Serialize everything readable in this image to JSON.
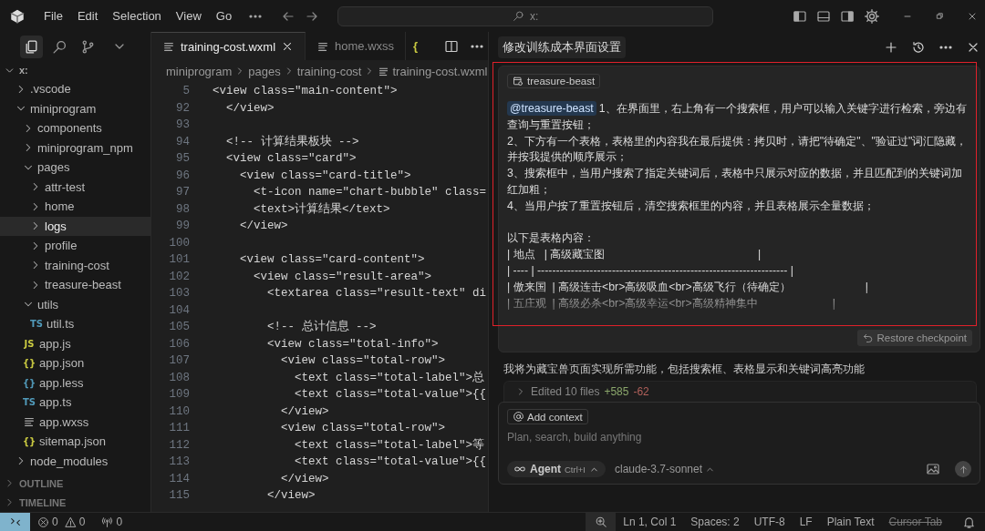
{
  "titlebar": {
    "menus": [
      "File",
      "Edit",
      "Selection",
      "View",
      "Go"
    ],
    "search": {
      "value": "x:"
    }
  },
  "activity": [
    {
      "selected": true
    },
    {
      "selected": false
    },
    {
      "selected": false
    }
  ],
  "explorer": {
    "root": "x:",
    "expanded": true,
    "tree": [
      {
        "label": ".vscode",
        "kind": "folder",
        "expanded": false,
        "selected": false
      },
      {
        "label": "miniprogram",
        "kind": "folder",
        "expanded": true,
        "selected": false,
        "children": [
          {
            "label": "components",
            "kind": "folder",
            "expanded": false,
            "selected": false
          },
          {
            "label": "miniprogram_npm",
            "kind": "folder",
            "expanded": false,
            "selected": false
          },
          {
            "label": "pages",
            "kind": "folder",
            "expanded": true,
            "selected": false,
            "children": [
              {
                "label": "attr-test",
                "kind": "folder",
                "expanded": false,
                "selected": false
              },
              {
                "label": "home",
                "kind": "folder",
                "expanded": false,
                "selected": false
              },
              {
                "label": "logs",
                "kind": "folder",
                "expanded": false,
                "selected": true
              },
              {
                "label": "profile",
                "kind": "folder",
                "expanded": false,
                "selected": false
              },
              {
                "label": "training-cost",
                "kind": "folder",
                "expanded": false,
                "selected": false
              },
              {
                "label": "treasure-beast",
                "kind": "folder",
                "expanded": false,
                "selected": false
              }
            ]
          },
          {
            "label": "utils",
            "kind": "folder",
            "expanded": true,
            "selected": false,
            "children": [
              {
                "label": "util.ts",
                "kind": "ts",
                "icon_text": "TS",
                "selected": false
              }
            ]
          },
          {
            "label": "app.js",
            "kind": "js",
            "icon_text": "JS",
            "selected": false
          },
          {
            "label": "app.json",
            "kind": "json",
            "icon_text": "{}",
            "selected": false
          },
          {
            "label": "app.less",
            "kind": "less",
            "icon_text": "{}",
            "selected": false
          },
          {
            "label": "app.ts",
            "kind": "ts",
            "icon_text": "TS",
            "selected": false
          },
          {
            "label": "app.wxss",
            "kind": "lines",
            "selected": false
          },
          {
            "label": "sitemap.json",
            "kind": "json",
            "icon_text": "{}",
            "selected": false
          }
        ]
      },
      {
        "label": "node_modules",
        "kind": "folder",
        "expanded": false,
        "selected": false
      }
    ],
    "sections": [
      {
        "label": "OUTLINE",
        "expanded": false
      },
      {
        "label": "TIMELINE",
        "expanded": false
      }
    ]
  },
  "editor": {
    "tabs": [
      {
        "label": "training-cost.wxml",
        "kind": "lines",
        "selected": true
      },
      {
        "label": "home.wxss",
        "kind": "lines",
        "selected": false
      },
      {
        "kind": "json",
        "icon_text": "{",
        "selected": false
      }
    ],
    "breadcrumbs": [
      "miniprogram",
      "pages",
      "training-cost",
      "training-cost.wxml"
    ],
    "lines": [
      {
        "num": "5",
        "text": "<view class=\"main-content\">"
      },
      {
        "num": "92",
        "text": "  </view>"
      },
      {
        "num": "93"
      },
      {
        "num": "94",
        "text": "  <!-- 计算结果板块 -->"
      },
      {
        "num": "95",
        "text": "  <view class=\"card\">"
      },
      {
        "num": "96",
        "text": "    <view class=\"card-title\">"
      },
      {
        "num": "97",
        "text": "      <t-icon name=\"chart-bubble\" class="
      },
      {
        "num": "98",
        "text": "      <text>计算结果</text>"
      },
      {
        "num": "99",
        "text": "    </view>"
      },
      {
        "num": "100"
      },
      {
        "num": "101",
        "text": "    <view class=\"card-content\">"
      },
      {
        "num": "102",
        "text": "      <view class=\"result-area\">"
      },
      {
        "num": "103",
        "text": "        <textarea class=\"result-text\" di"
      },
      {
        "num": "104"
      },
      {
        "num": "105",
        "text": "        <!-- 总计信息 -->"
      },
      {
        "num": "106",
        "text": "        <view class=\"total-info\">"
      },
      {
        "num": "107",
        "text": "          <view class=\"total-row\">"
      },
      {
        "num": "108",
        "text": "            <text class=\"total-label\">总"
      },
      {
        "num": "109",
        "text": "            <text class=\"total-value\">{{"
      },
      {
        "num": "110",
        "text": "          </view>"
      },
      {
        "num": "111",
        "text": "          <view class=\"total-row\">"
      },
      {
        "num": "112",
        "text": "            <text class=\"total-label\">等"
      },
      {
        "num": "113",
        "text": "            <text class=\"total-value\">{{"
      },
      {
        "num": "114",
        "text": "          </view>"
      },
      {
        "num": "115",
        "text": "        </view>"
      }
    ]
  },
  "chat": {
    "title": "修改训练成本界面设置",
    "message": {
      "highlighted": true,
      "context": "treasure-beast",
      "mention": "@treasure-beast",
      "lines": [
        {
          "kind": "item",
          "text": "1、在界面里，右上角有一个搜索框，用户可以输入关键字进行检索，旁边有查询与重置按钮；"
        },
        {
          "kind": "item",
          "text": "2、下方有一个表格，表格里的内容我在最后提供：拷贝时，请把\"待确定\"、\"验证过\"词汇隐藏，并按我提供的顺序展示；"
        },
        {
          "kind": "item",
          "text": "3、搜索框中，当用户搜索了指定关键词后，表格中只展示对应的数据，并且匹配到的关键词加红加粗；"
        },
        {
          "kind": "item",
          "text": "4、当用户按了重置按钮后，清空搜索框里的内容，并且表格展示全量数据；"
        },
        {
          "kind": "text",
          "text": "以下是表格内容："
        },
        {
          "kind": "table-row",
          "text": "| 地点   | 高级藏宝图                                                 |"
        },
        {
          "kind": "table-row",
          "text": "| ---- | ------------------------------------------------------------------- |"
        },
        {
          "kind": "table-row",
          "text": "| 傲来国  | 高级连击<br>高级吸血<br>高级飞行（待确定）                        |"
        },
        {
          "kind": "table-row",
          "text": "| 五庄观  | 高级必杀<br>高级幸运<br>高级精神集中                        |"
        }
      ],
      "restore": "Restore checkpoint"
    },
    "reply": "我将为藏宝兽页面实现所需功能，包括搜索框、表格显示和关键词高亮功能",
    "edits": {
      "label": "Edited 10 files",
      "added": "+585",
      "removed": "-62",
      "expanded": false
    },
    "composer": {
      "context_button": "Add context",
      "placeholder": "Plan, search, build anything",
      "mode": "Agent",
      "shortcut": "Ctrl+I",
      "model": "claude-3.7-sonnet"
    }
  },
  "statusbar": {
    "errors": "0",
    "warnings": "0",
    "ports": "0",
    "items": [
      {
        "label": "Ln 1, Col 1",
        "disabled": false
      },
      {
        "label": "Spaces: 2",
        "disabled": false
      },
      {
        "label": "UTF-8",
        "disabled": false
      },
      {
        "label": "LF",
        "disabled": false
      },
      {
        "label": "Plain Text",
        "disabled": false
      },
      {
        "label": "Cursor Tab",
        "disabled": true
      }
    ]
  }
}
